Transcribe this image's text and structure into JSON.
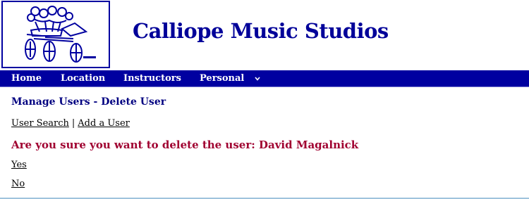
{
  "site": {
    "title": "Calliope Music Studios"
  },
  "logo": {
    "icon": "flower-cart-logo"
  },
  "nav": {
    "items": [
      {
        "label": "Home"
      },
      {
        "label": "Location"
      },
      {
        "label": "Instructors"
      },
      {
        "label": "Personal",
        "has_dropdown": true
      }
    ],
    "dropdown_icon": "chevron-down-icon"
  },
  "page": {
    "heading": "Manage Users - Delete User",
    "links": {
      "user_search": "User Search",
      "separator": "|",
      "add_user": "Add a User"
    },
    "confirm_message": "Are you sure you want to delete the user: David Magalnick",
    "yes_label": "Yes",
    "no_label": "No"
  },
  "colors": {
    "brand_blue": "#0000a0",
    "title_blue": "#000099",
    "heading_navy": "#000080",
    "warning_red": "#a00030"
  }
}
